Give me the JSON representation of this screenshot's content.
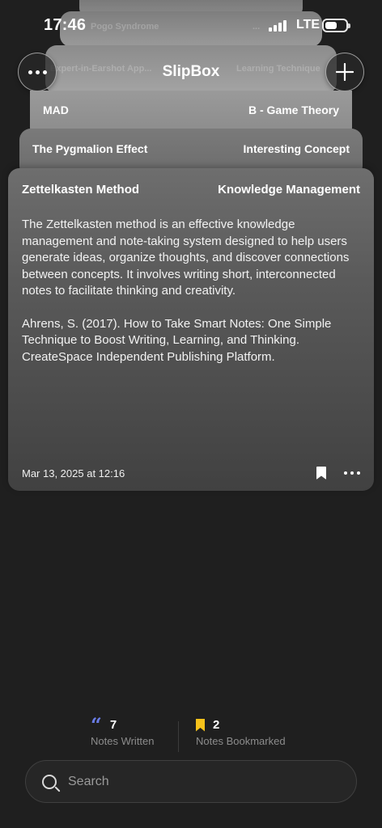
{
  "status_bar": {
    "time": "17:46",
    "network": "LTE",
    "battery_level": 0.6
  },
  "nav": {
    "title": "SlipBox"
  },
  "background_cards": [
    {
      "title": "Pogo Syndrome",
      "tag": "..."
    },
    {
      "title": "Expert-in-Earshot App...",
      "tag": "Learning Technique"
    }
  ],
  "cards": [
    {
      "title": "MAD",
      "tag": "B - Game Theory"
    },
    {
      "title": "The Pygmalion Effect",
      "tag": "Interesting Concept"
    }
  ],
  "main_card": {
    "title": "Zettelkasten Method",
    "tag": "Knowledge Management",
    "body": "The Zettelkasten method is an effective knowledge management and note-taking system designed to help users generate ideas, organize thoughts, and discover connections between concepts. It involves writing short, interconnected notes to facilitate thinking and creativity.",
    "reference": "Ahrens, S. (2017). How to Take Smart Notes: One Simple Technique to Boost Writing, Learning, and Thinking. CreateSpace Independent Publishing Platform.",
    "date": "Mar 13, 2025 at 12:16"
  },
  "stats": {
    "written": {
      "value": "7",
      "label": "Notes Written"
    },
    "bookmarked": {
      "value": "2",
      "label": "Notes Bookmarked"
    }
  },
  "search": {
    "placeholder": "Search"
  },
  "colors": {
    "background": "#1f1f1f",
    "quote_accent": "#6a7de8",
    "bookmark_accent": "#f6c21b"
  }
}
